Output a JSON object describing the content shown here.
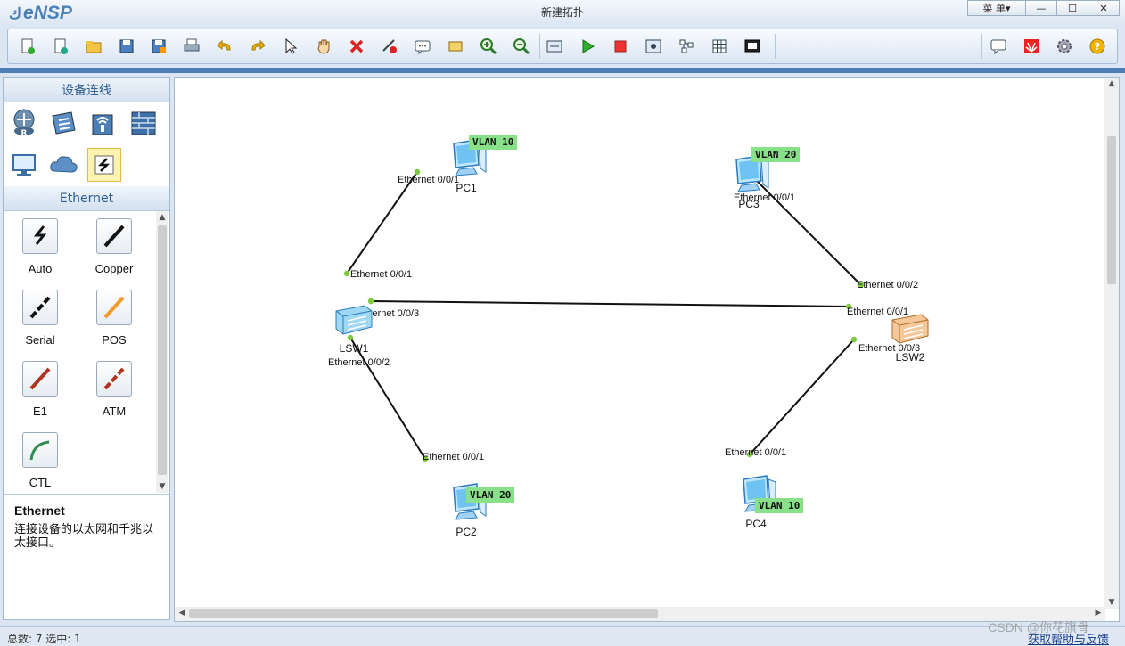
{
  "app": {
    "name": "eNSP",
    "window_title": "新建拓扑",
    "menu_label": "菜 单",
    "menu_arrow": "▾"
  },
  "window_controls": {
    "minimize": "—",
    "maximize": "☐",
    "close": "✕"
  },
  "toolbar": [
    "new-topology-icon",
    "new-lab-icon",
    "open-icon",
    "save-icon",
    "save-as-icon",
    "print-icon",
    "undo-icon",
    "redo-icon",
    "select-icon",
    "pan-hand-icon",
    "delete-icon",
    "delete-link-icon",
    "text-note-icon",
    "rectangle-icon",
    "zoom-in-icon",
    "zoom-out-icon",
    "fit-icon",
    "start-icon",
    "stop-icon",
    "capture-icon",
    "topology-icon",
    "grid-icon",
    "screenshot-icon",
    "chat-icon",
    "huawei-icon",
    "settings-icon",
    "help-icon"
  ],
  "left_panel": {
    "section_title": "设备连线",
    "devices": [
      "router-icon",
      "switch-icon",
      "wireless-icon",
      "firewall-icon",
      "pc-icon",
      "cloud-icon",
      "connection-icon"
    ],
    "selected_device": "connection-icon",
    "cable_section_title": "Ethernet",
    "cables": [
      {
        "label": "Auto",
        "color": "#111111"
      },
      {
        "label": "Copper",
        "color": "#111111"
      },
      {
        "label": "Serial",
        "color": "#111111"
      },
      {
        "label": "POS",
        "color": "#f39a2a"
      },
      {
        "label": "E1",
        "color": "#b0321f"
      },
      {
        "label": "ATM",
        "color": "#b0321f"
      },
      {
        "label": "CTL",
        "color": "#2f8f4f"
      }
    ],
    "description_title": "Ethernet",
    "description_body": "连接设备的以太网和千兆以太接口。"
  },
  "topology": {
    "nodes": [
      {
        "id": "PC1",
        "label": "PC1",
        "type": "pc",
        "vlan": "VLAN 10"
      },
      {
        "id": "PC2",
        "label": "PC2",
        "type": "pc",
        "vlan": "VLAN 20"
      },
      {
        "id": "PC3",
        "label": "PC3",
        "type": "pc",
        "vlan": "VLAN 20"
      },
      {
        "id": "PC4",
        "label": "PC4",
        "type": "pc",
        "vlan": "VLAN 10"
      },
      {
        "id": "LSW1",
        "label": "LSW1",
        "type": "switch"
      },
      {
        "id": "LSW2",
        "label": "LSW2",
        "type": "switch"
      }
    ],
    "links": [
      {
        "a": "LSW1",
        "a_port": "Ethernet 0/0/1",
        "b": "PC1",
        "b_port": "Ethernet 0/0/1"
      },
      {
        "a": "LSW1",
        "a_port": "Ethernet 0/0/2",
        "b": "PC2",
        "b_port": "Ethernet 0/0/1"
      },
      {
        "a": "LSW1",
        "a_port": "Ethernet 0/0/3",
        "b": "LSW2",
        "b_port": "Ethernet 0/0/1"
      },
      {
        "a": "LSW2",
        "a_port": "Ethernet 0/0/2",
        "b": "PC3",
        "b_port": "Ethernet 0/0/1"
      },
      {
        "a": "LSW2",
        "a_port": "Ethernet 0/0/3",
        "b": "PC4",
        "b_port": "Ethernet 0/0/1"
      }
    ],
    "link_color": "#111111",
    "port_dot_color": "#7ccb3d",
    "vlan_tag_color": "#88e088"
  },
  "status": {
    "total_label": "总数: 7 选中: 1",
    "help_link": "获取帮助与反馈"
  },
  "watermark": "CSDN @你花旗骨"
}
